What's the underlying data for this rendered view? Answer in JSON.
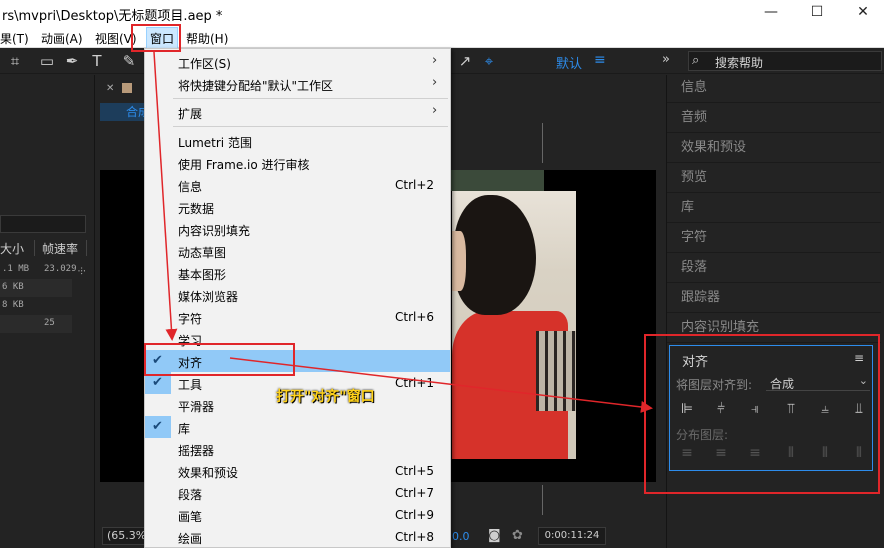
{
  "window": {
    "title": "rs\\mvpri\\Desktop\\无标题项目.aep *",
    "minimize": "—",
    "maximize": "☐",
    "close": "✕"
  },
  "menubar": {
    "items": [
      "果(T)",
      "动画(A)",
      "视图(V)",
      "窗口",
      "帮助(H)"
    ]
  },
  "toolbar": {
    "workspace": "默认",
    "workspace_menu": "≡",
    "more": "»",
    "search_placeholder": "搜索帮助"
  },
  "project_panel": {
    "columns": [
      "大小",
      "帧速率"
    ],
    "rows": [
      {
        "size": ".1 MB",
        "fps": "23.029"
      },
      {
        "size": "6 KB",
        "fps": ""
      },
      {
        "size": "8 KB",
        "fps": ""
      },
      {
        "size": "",
        "fps": "25"
      }
    ]
  },
  "composition": {
    "tab_label": "合成",
    "zoom": "(65.3%",
    "time_fragment": "0.0",
    "timecode": "0:00:11:24"
  },
  "window_menu": {
    "items": [
      {
        "label": "工作区(S)",
        "shortcut": "",
        "submenu": true,
        "checked": false
      },
      {
        "label": "将快捷键分配给\"默认\"工作区",
        "shortcut": "",
        "submenu": true,
        "checked": false
      },
      {
        "label": "扩展",
        "shortcut": "",
        "submenu": true,
        "checked": false
      },
      {
        "label": "Lumetri 范围",
        "shortcut": "",
        "submenu": false,
        "checked": false
      },
      {
        "label": "使用 Frame.io 进行审核",
        "shortcut": "",
        "submenu": false,
        "checked": false
      },
      {
        "label": "信息",
        "shortcut": "Ctrl+2",
        "submenu": false,
        "checked": false
      },
      {
        "label": "元数据",
        "shortcut": "",
        "submenu": false,
        "checked": false
      },
      {
        "label": "内容识别填充",
        "shortcut": "",
        "submenu": false,
        "checked": false
      },
      {
        "label": "动态草图",
        "shortcut": "",
        "submenu": false,
        "checked": false
      },
      {
        "label": "基本图形",
        "shortcut": "",
        "submenu": false,
        "checked": false
      },
      {
        "label": "媒体浏览器",
        "shortcut": "",
        "submenu": false,
        "checked": false
      },
      {
        "label": "字符",
        "shortcut": "Ctrl+6",
        "submenu": false,
        "checked": false
      },
      {
        "label": "学习",
        "shortcut": "",
        "submenu": false,
        "checked": false
      },
      {
        "label": "对齐",
        "shortcut": "",
        "submenu": false,
        "checked": true
      },
      {
        "label": "工具",
        "shortcut": "Ctrl+1",
        "submenu": false,
        "checked": true
      },
      {
        "label": "平滑器",
        "shortcut": "",
        "submenu": false,
        "checked": false
      },
      {
        "label": "库",
        "shortcut": "",
        "submenu": false,
        "checked": true
      },
      {
        "label": "摇摆器",
        "shortcut": "",
        "submenu": false,
        "checked": false
      },
      {
        "label": "效果和预设",
        "shortcut": "Ctrl+5",
        "submenu": false,
        "checked": false
      },
      {
        "label": "段落",
        "shortcut": "Ctrl+7",
        "submenu": false,
        "checked": false
      },
      {
        "label": "画笔",
        "shortcut": "Ctrl+9",
        "submenu": false,
        "checked": false
      },
      {
        "label": "绘画",
        "shortcut": "Ctrl+8",
        "submenu": false,
        "checked": false
      }
    ],
    "highlighted": "对齐"
  },
  "right_panel": {
    "items": [
      "信息",
      "音频",
      "效果和预设",
      "预览",
      "库",
      "字符",
      "段落",
      "跟踪器",
      "内容识别填充"
    ]
  },
  "align_panel": {
    "title": "对齐",
    "menu_icon": "≡",
    "align_to_label": "将图层对齐到:",
    "align_to_value": "合成",
    "distribute_label": "分布图层:"
  },
  "annotation": {
    "text": "打开\"对齐\"窗口",
    "color": "#ffd21a",
    "box_color": "#e0262a"
  },
  "colors": {
    "accent": "#2d8ceb",
    "menu_highlight": "#91c9f7"
  }
}
